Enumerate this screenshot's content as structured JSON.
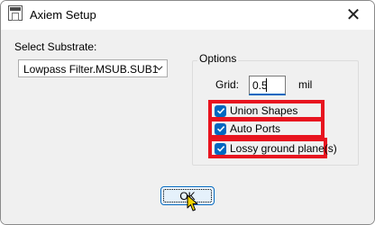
{
  "window": {
    "title": "Axiem Setup",
    "close_glyph": "✕"
  },
  "substrate": {
    "label": "Select Substrate:",
    "selected": "Lowpass Filter.MSUB.SUB1"
  },
  "options": {
    "group_label": "Options",
    "grid_label": "Grid:",
    "grid_value": "0.5",
    "grid_unit": "mil",
    "checkboxes": [
      {
        "label": "Union Shapes",
        "checked": true
      },
      {
        "label": "Auto Ports",
        "checked": true
      },
      {
        "label": "Lossy ground plane(s)",
        "checked": true
      }
    ]
  },
  "buttons": {
    "ok": "OK"
  },
  "colors": {
    "accent": "#0067c0",
    "highlight": "#e8141f"
  },
  "icons": {
    "app": "window-app-icon",
    "close": "close-icon",
    "dropdown": "chevron-down-icon",
    "cursor": "mouse-pointer-icon"
  }
}
